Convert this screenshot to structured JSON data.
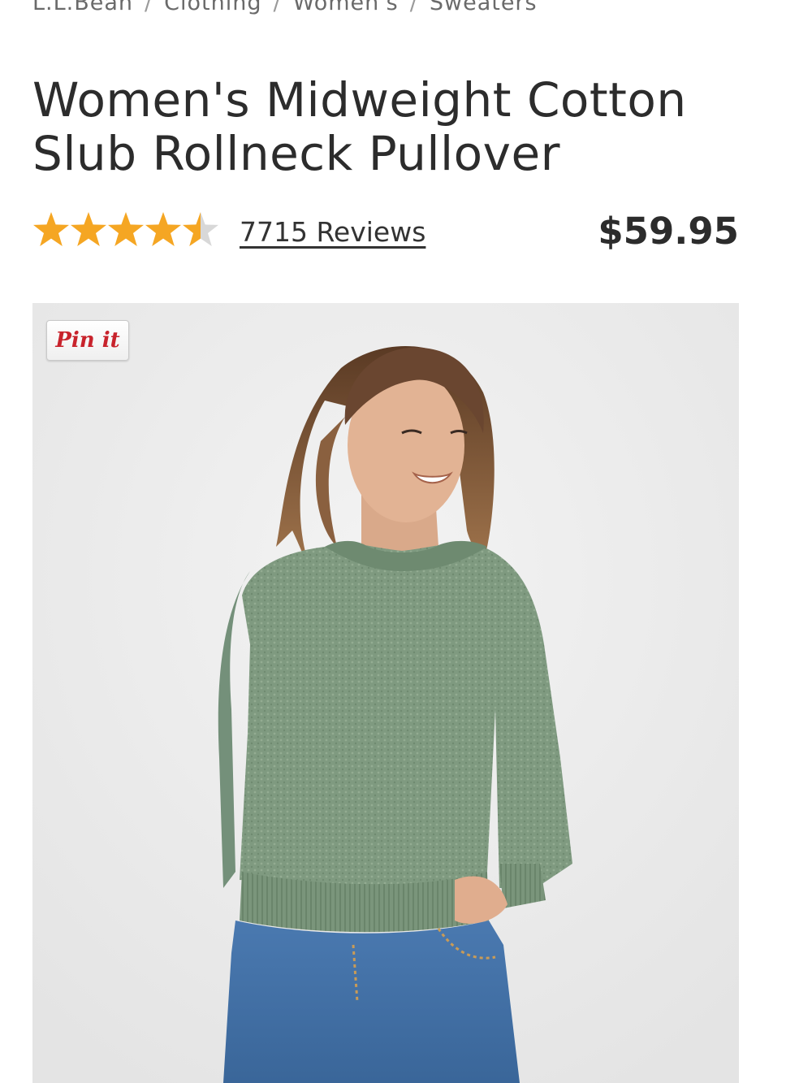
{
  "breadcrumb": {
    "items": [
      "L.L.Bean",
      "Clothing",
      "Women's",
      "Sweaters"
    ],
    "separator": "/"
  },
  "product": {
    "title": "Women's Midweight Cotton Slub Rollneck Pullover",
    "rating": 4.5,
    "rating_max": 5,
    "reviews_label": "7715 Reviews",
    "price": "$59.95"
  },
  "pin_button": {
    "label": "Pin it"
  },
  "colors": {
    "star": "#f5a623",
    "star_empty": "#d8d8d8",
    "pin": "#c8232c",
    "sweater": "#7f9a80",
    "jeans": "#3f6ea5",
    "image_bg": "#ebebeb"
  }
}
